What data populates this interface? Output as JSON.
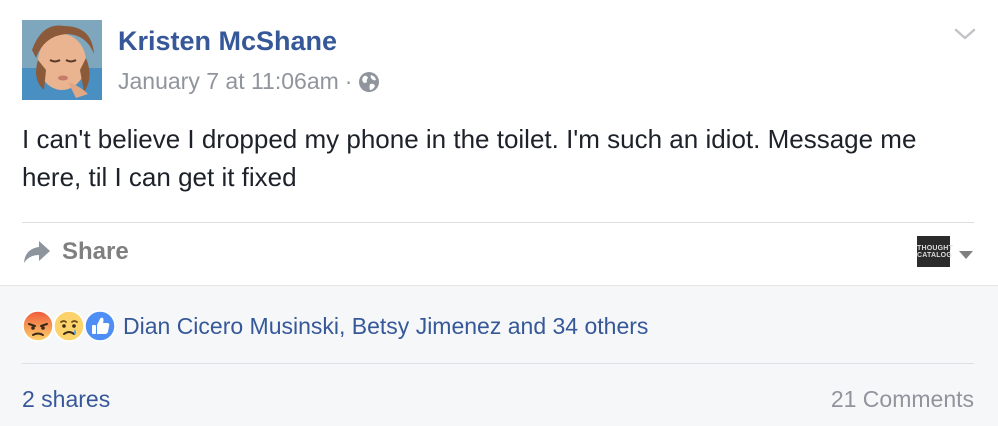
{
  "post": {
    "author": "Kristen McShane",
    "timestamp": "January 7 at 11:06am",
    "separator": "·",
    "privacy_icon": "globe-icon",
    "options_icon": "chevron-down-icon",
    "message": "I can't believe I dropped my phone in the toilet. I'm such an idiot. Message me here, til I can get it fixed"
  },
  "actions": {
    "share_label": "Share",
    "share_icon": "share-arrow-icon",
    "page_thumbnail_text": "THOUGHT CATALOG",
    "page_selector_icon": "caret-down-icon"
  },
  "engagement": {
    "reaction_icons": [
      "angry-reaction-icon",
      "sad-reaction-icon",
      "like-reaction-icon"
    ],
    "reactors_text": "Dian Cicero Musinski, Betsy Jimenez and 34 others",
    "shares_text": "2 shares",
    "comments_text": "21 Comments"
  },
  "colors": {
    "link_blue": "#365899",
    "meta_gray": "#90949c",
    "footer_bg": "#f6f7f9",
    "like_blue": "#4f8ef5",
    "reaction_yellow": "#fcd36b",
    "angry_orange": "#f07d42"
  }
}
